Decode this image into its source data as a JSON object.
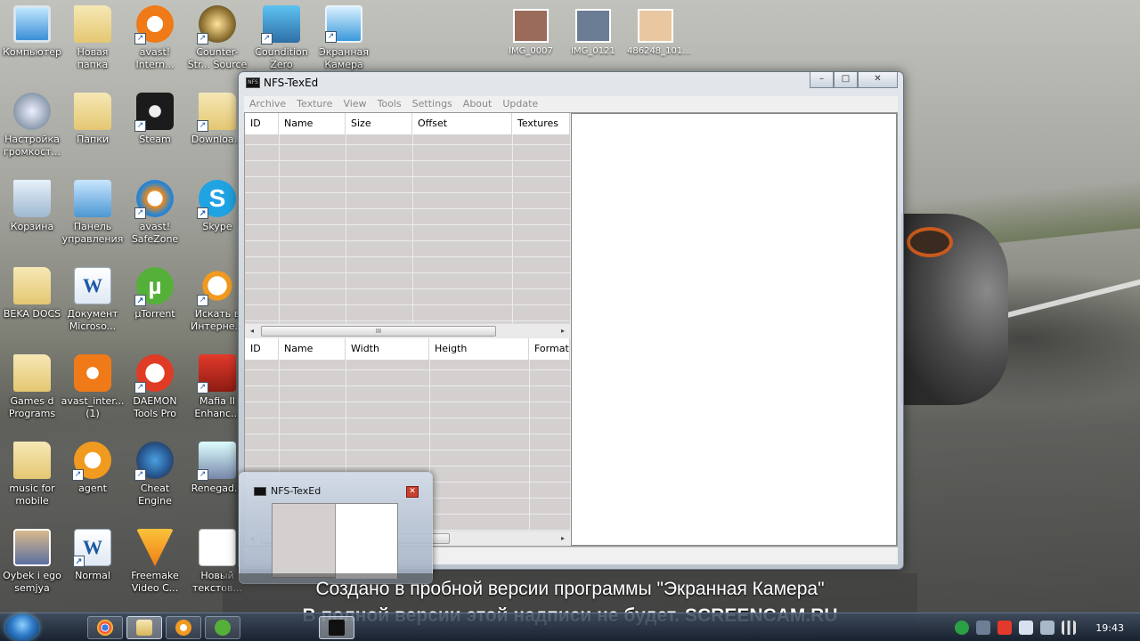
{
  "desktop": {
    "icons": [
      {
        "id": "computer",
        "label": "Компьютер",
        "kind": "pc",
        "shortcut": false
      },
      {
        "id": "new-folder",
        "label": "Новая папка",
        "kind": "folder",
        "shortcut": false
      },
      {
        "id": "avast",
        "label": "avast! Intern...",
        "kind": "avast",
        "shortcut": true
      },
      {
        "id": "cs-source",
        "label": "Counter-Str... Source",
        "kind": "cs",
        "shortcut": true
      },
      {
        "id": "condition-zero",
        "label": "Coundition Zero",
        "kind": "czero",
        "shortcut": true
      },
      {
        "id": "screen-camera",
        "label": "Экранная Камера",
        "kind": "cam",
        "shortcut": true
      },
      {
        "id": "sound-settings",
        "label": "Настройка громкост...",
        "kind": "sound",
        "shortcut": false
      },
      {
        "id": "folders",
        "label": "Папки",
        "kind": "folder",
        "shortcut": false
      },
      {
        "id": "steam",
        "label": "Steam",
        "kind": "steam",
        "shortcut": true
      },
      {
        "id": "downloads",
        "label": "Downloa...",
        "kind": "folder",
        "shortcut": true
      },
      {
        "id": "recycle-bin",
        "label": "Корзина",
        "kind": "trash",
        "shortcut": false
      },
      {
        "id": "control-panel",
        "label": "Панель управления",
        "kind": "panel",
        "shortcut": false
      },
      {
        "id": "avast-safezone",
        "label": "avast! SafeZone",
        "kind": "safe",
        "shortcut": true
      },
      {
        "id": "skype",
        "label": "Skype",
        "kind": "skype",
        "shortcut": true
      },
      {
        "id": "beka-docs",
        "label": "BEKA DOCS",
        "kind": "folder",
        "shortcut": false
      },
      {
        "id": "word-doc",
        "label": "Документ Microso...",
        "kind": "word",
        "shortcut": false
      },
      {
        "id": "utorrent",
        "label": "µTorrent",
        "kind": "utorrent",
        "shortcut": true
      },
      {
        "id": "search-internet",
        "label": "Искать в Интерне...",
        "kind": "search",
        "shortcut": true
      },
      {
        "id": "games-programs",
        "label": "Games d Programs",
        "kind": "folder",
        "shortcut": false
      },
      {
        "id": "avast-inter",
        "label": "avast_inter... (1)",
        "kind": "avastint",
        "shortcut": false
      },
      {
        "id": "daemon-tools",
        "label": "DAEMON Tools Pro",
        "kind": "daemon",
        "shortcut": true
      },
      {
        "id": "mafia",
        "label": "Mafia II Enhanc...",
        "kind": "mafia",
        "shortcut": true
      },
      {
        "id": "music-mobile",
        "label": "music for mobile",
        "kind": "folder",
        "shortcut": false
      },
      {
        "id": "agent",
        "label": "agent",
        "kind": "mailagent",
        "shortcut": true
      },
      {
        "id": "cheat-engine",
        "label": "Cheat Engine",
        "kind": "cheat",
        "shortcut": true
      },
      {
        "id": "renegade",
        "label": "Renegad...",
        "kind": "renegade",
        "shortcut": true
      },
      {
        "id": "oybek",
        "label": "Oybek i ego semjya",
        "kind": "photo",
        "shortcut": false
      },
      {
        "id": "normal",
        "label": "Normal",
        "kind": "word",
        "shortcut": true
      },
      {
        "id": "freemake",
        "label": "Freemake Video C...",
        "kind": "freemake",
        "shortcut": true
      },
      {
        "id": "new-text",
        "label": "Новый текстов...",
        "kind": "doc",
        "shortcut": false
      }
    ],
    "thumbnails": [
      {
        "label": "IMG_0007",
        "color": "#9a6b5a"
      },
      {
        "label": "IMG_0121",
        "color": "#6a7d94"
      },
      {
        "label": "486248_101...",
        "color": "#e9c7a1"
      }
    ]
  },
  "window": {
    "title": "NFS-TexEd",
    "app_icon_text": "NFS",
    "btn_min": "–",
    "btn_max": "□",
    "btn_close": "✕",
    "menu": [
      "Archive",
      "Texture",
      "View",
      "Tools",
      "Settings",
      "About",
      "Update"
    ],
    "archive_table": {
      "columns": [
        "ID",
        "Name",
        "Size",
        "Offset",
        "Textures"
      ]
    },
    "texture_table": {
      "columns": [
        "ID",
        "Name",
        "Width",
        "Heigth",
        "Format"
      ]
    },
    "scroll_left": "◂",
    "scroll_right": "▸",
    "scroll_grip": "III"
  },
  "popup": {
    "title": "NFS-TexEd",
    "close": "✕"
  },
  "watermark": {
    "line1": "Создано в пробной версии программы \"Экранная Камера\"",
    "line2": "В полной версии этой надписи не будет. SCREENCAM.RU"
  },
  "taskbar": {
    "clock": "19:43"
  }
}
